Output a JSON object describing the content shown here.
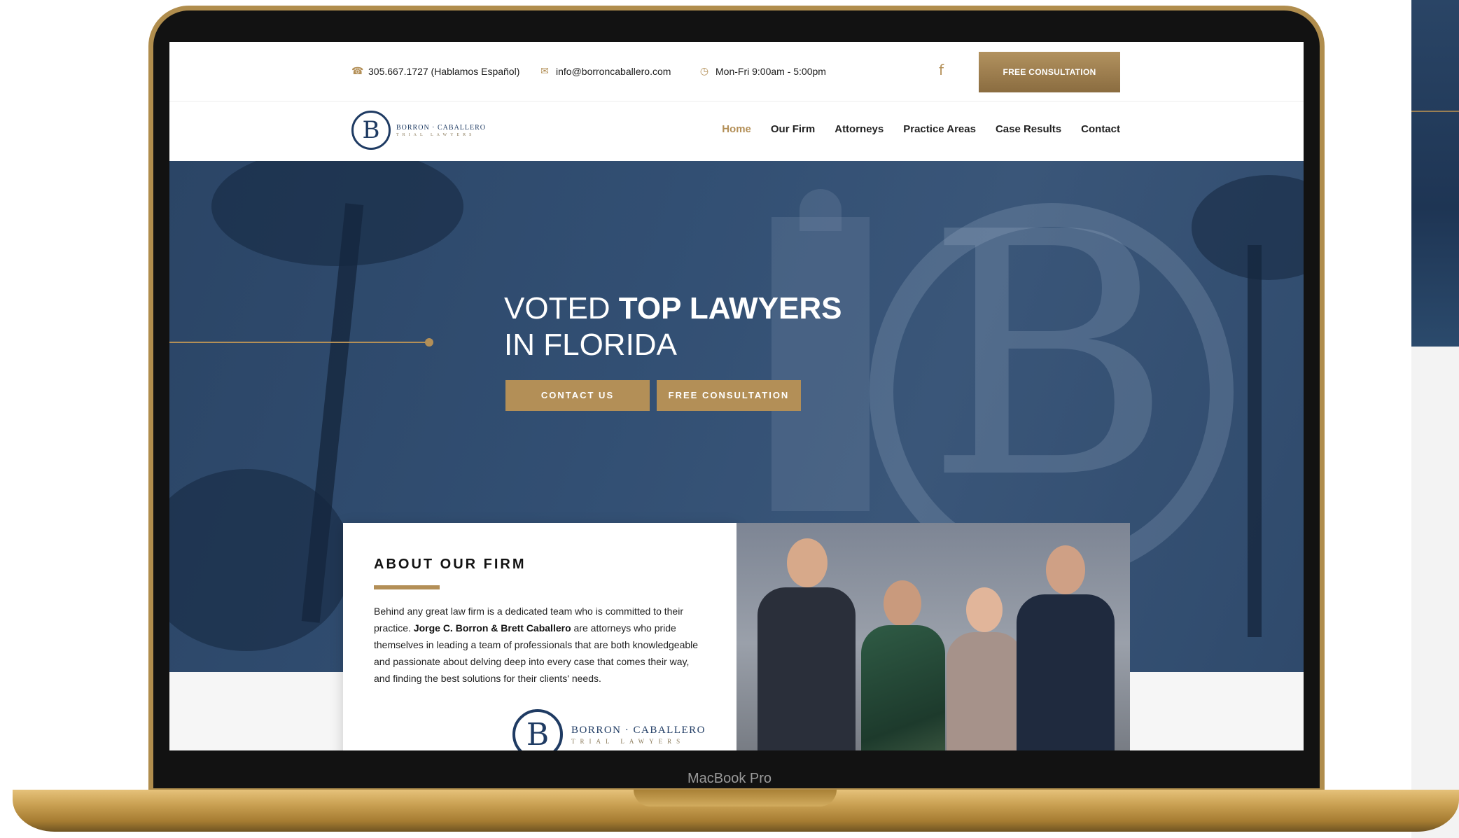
{
  "topbar": {
    "phone": "305.667.1727 (Hablamos Español)",
    "email": "info@borroncaballero.com",
    "hours": "Mon-Fri 9:00am - 5:00pm",
    "facebook_icon": "f",
    "cta": "FREE CONSULTATION"
  },
  "logo": {
    "mark": "B",
    "name": "BORRON · CABALLERO",
    "sub": "TRIAL LAWYERS"
  },
  "nav": {
    "items": [
      "Home",
      "Our Firm",
      "Attorneys",
      "Practice Areas",
      "Case Results",
      "Contact"
    ],
    "active": "Home"
  },
  "hero": {
    "title_light_1": "VOTED ",
    "title_bold": "TOP LAWYERS",
    "title_light_2": "IN FLORIDA",
    "contact_button": "CONTACT US",
    "consult_button": "FREE CONSULTATION"
  },
  "about": {
    "title": "ABOUT OUR FIRM",
    "text_1": "Behind any great law firm is a dedicated team who is committed to their practice. ",
    "text_bold": "Jorge C. Borron & Brett Caballero",
    "text_2": " are attorneys who pride themselves in leading a team of professionals that are both knowledgeable and passionate about delving deep into every case that comes their way, and finding the best solutions for their clients' needs."
  },
  "device": {
    "label": "MacBook Pro"
  },
  "colors": {
    "gold": "#b38f57",
    "navy": "#1f3b63",
    "hero_blue": "#324f73"
  }
}
